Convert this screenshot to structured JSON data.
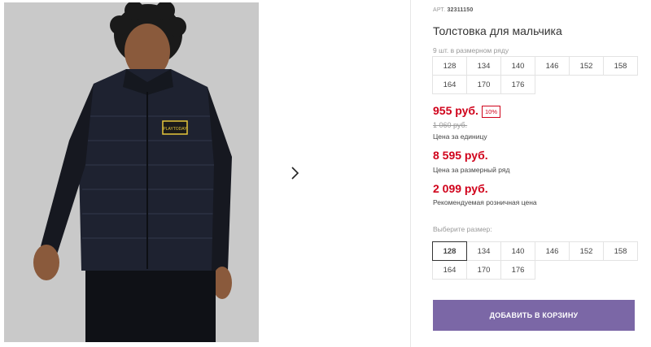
{
  "product": {
    "article_label": "АРТ.",
    "article_number": "32311150",
    "title": "Толстовка для мальчика",
    "pack_note": "9 шт. в размерном ряду",
    "pack_sizes": [
      "128",
      "134",
      "140",
      "146",
      "152",
      "158",
      "164",
      "170",
      "176"
    ]
  },
  "pricing": {
    "price_now": "955 руб.",
    "discount": "10%",
    "price_old": "1 060 руб.",
    "unit_note": "Цена за единицу",
    "pack_price": "8 595 руб.",
    "pack_price_note": "Цена за размерный ряд",
    "rrp": "2 099 руб.",
    "rrp_note": "Рекомендуемая розничная цена"
  },
  "size_select": {
    "label": "Выберите размер:",
    "selected": "128",
    "options": [
      "128",
      "134",
      "140",
      "146",
      "152",
      "158",
      "164",
      "170",
      "176"
    ]
  },
  "actions": {
    "add_to_cart": "ДОБАВИТЬ В КОРЗИНУ"
  },
  "gallery": {
    "image_subject": "boy-in-black-jacket",
    "next_icon": "chevron-right-icon",
    "patch_text": "PLAYTODAY"
  },
  "colors": {
    "accent": "#7b67a6",
    "price_red": "#d0021b"
  }
}
